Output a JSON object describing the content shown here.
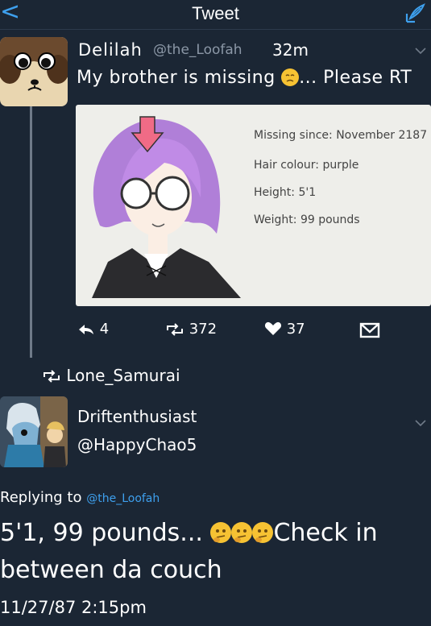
{
  "header": {
    "title": "Tweet",
    "back_label": "<"
  },
  "tweet": {
    "author_name": "Delilah",
    "author_handle": "@the_Loofah",
    "time": "32m",
    "text_before": "My brother is missing",
    "text_after": "... Please RT",
    "card": {
      "missing_since": "Missing since: November 2187",
      "hair_colour": "Hair colour: purple",
      "height": "Height: 5'1",
      "weight": "Weight: 99 pounds"
    },
    "actions": {
      "replies": "4",
      "retweets": "372",
      "likes": "37"
    }
  },
  "retweet_banner": {
    "text": "Lone_Samurai"
  },
  "reply": {
    "author_name": "Driftenthusiast",
    "author_handle": "@HappyChao5",
    "replying_to_label": "Replying to",
    "replying_to_handle": "@the_Loofah",
    "body_line1_before": "5'1, 99 pounds...",
    "body_line1_after": "Check in",
    "body_line2": "between da couch",
    "timestamp": "11/27/87 2:15pm"
  },
  "icons": {
    "accent": "#3ea0ee",
    "background": "#1b2634",
    "emoji_thinking": "thinking-face",
    "emoji_sad": "disappointed-face"
  }
}
